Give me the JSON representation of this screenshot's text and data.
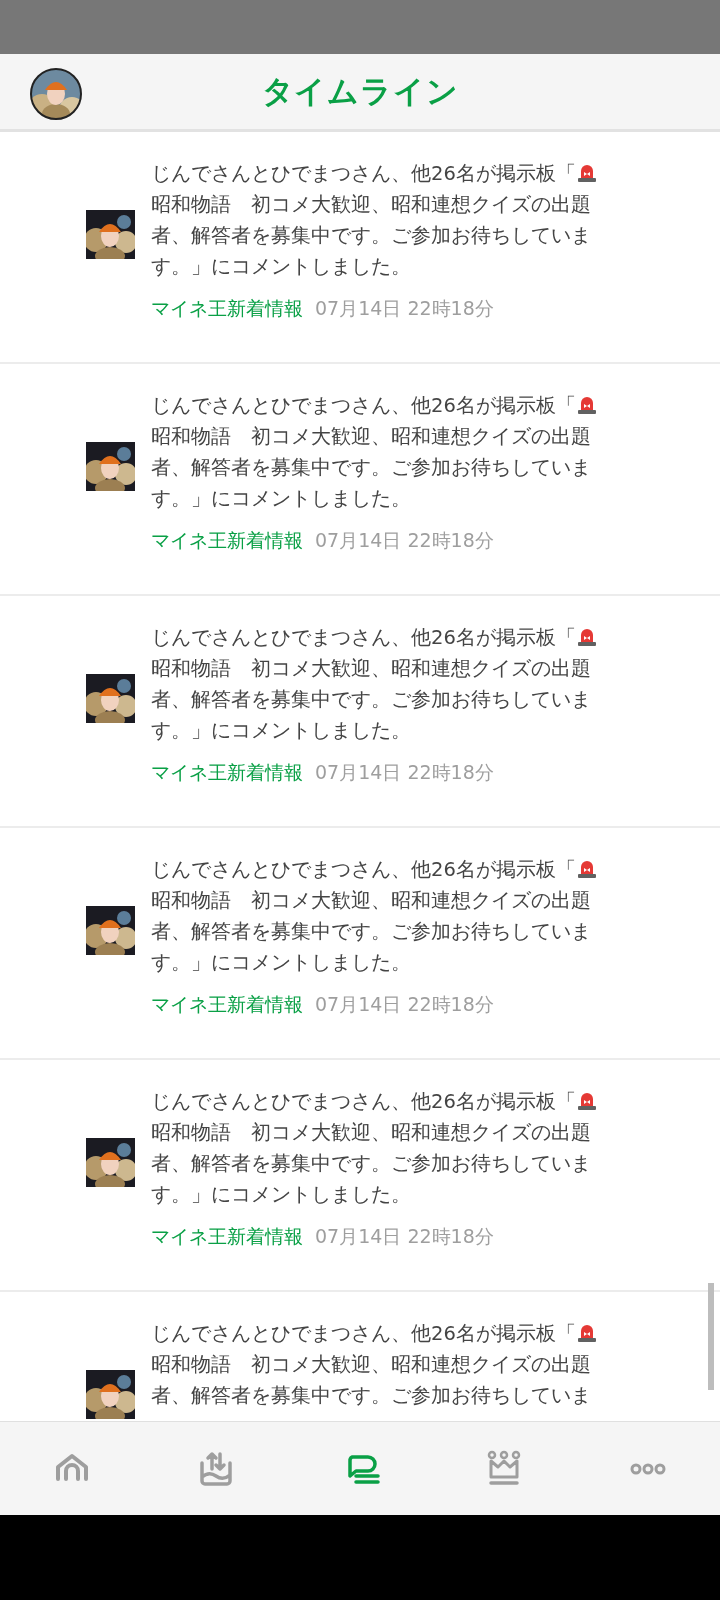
{
  "header": {
    "title": "タイムライン"
  },
  "timeline": [
    {
      "text": [
        "じんでさんとひでまつさん、他26名が掲示板「",
        "\n昭和物語　初コメ大歓迎、昭和連想クイズの出題者、解答者を募集中です。ご参加お待ちしています。」にコメントしました。"
      ],
      "source": "マイネ王新着情報",
      "time": "07月14日 22時18分"
    },
    {
      "text": [
        "じんでさんとひでまつさん、他26名が掲示板「",
        "\n昭和物語　初コメ大歓迎、昭和連想クイズの出題者、解答者を募集中です。ご参加お待ちしています。」にコメントしました。"
      ],
      "source": "マイネ王新着情報",
      "time": "07月14日 22時18分"
    },
    {
      "text": [
        "じんでさんとひでまつさん、他26名が掲示板「",
        "\n昭和物語　初コメ大歓迎、昭和連想クイズの出題者、解答者を募集中です。ご参加お待ちしています。」にコメントしました。"
      ],
      "source": "マイネ王新着情報",
      "time": "07月14日 22時18分"
    },
    {
      "text": [
        "じんでさんとひでまつさん、他26名が掲示板「",
        "\n昭和物語　初コメ大歓迎、昭和連想クイズの出題者、解答者を募集中です。ご参加お待ちしています。」にコメントしました。"
      ],
      "source": "マイネ王新着情報",
      "time": "07月14日 22時18分"
    },
    {
      "text": [
        "じんでさんとひでまつさん、他26名が掲示板「",
        "\n昭和物語　初コメ大歓迎、昭和連想クイズの出題者、解答者を募集中です。ご参加お待ちしています。」にコメントしました。"
      ],
      "source": "マイネ王新着情報",
      "time": "07月14日 22時18分"
    },
    {
      "text": [
        "じんでさんとひでまつさん、他26名が掲示板「",
        "\n昭和物語　初コメ大歓迎、昭和連想クイズの出題者、解答者を募集中です。ご参加お待ちしていま"
      ]
    }
  ],
  "nav": [
    {
      "kind": "home",
      "selected": false
    },
    {
      "kind": "tray",
      "selected": false
    },
    {
      "kind": "chat",
      "selected": true
    },
    {
      "kind": "crown",
      "selected": false
    },
    {
      "kind": "more",
      "selected": false
    }
  ]
}
